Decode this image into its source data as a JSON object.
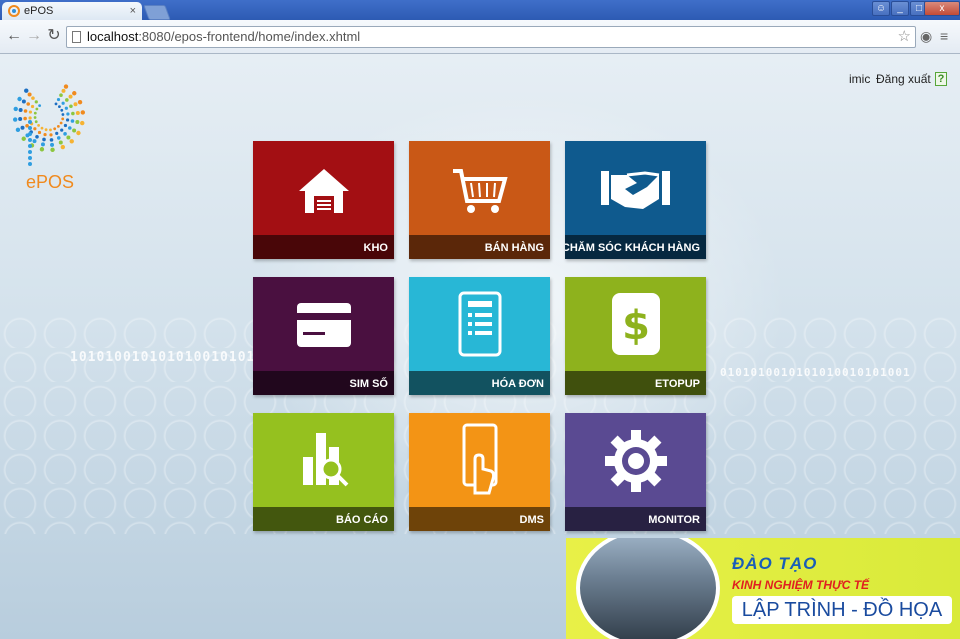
{
  "browser": {
    "tab_title": "ePOS",
    "tab_close": "×",
    "url_host": "localhost",
    "url_rest": ":8080/epos-frontend/home/index.xhtml",
    "win_buttons": [
      "_",
      "□",
      "x"
    ]
  },
  "header": {
    "logo_text": "ePOS",
    "username": "imic",
    "logout_label": "Đăng xuất",
    "help_label": "?"
  },
  "tiles": [
    {
      "label": "KHO",
      "color": "#a30f13",
      "icon": "warehouse-icon"
    },
    {
      "label": "BÁN HÀNG",
      "color": "#c95816",
      "icon": "shopping-cart-icon"
    },
    {
      "label": "CHĂM SÓC KHÁCH HÀNG",
      "color": "#0f5a8e",
      "icon": "handshake-icon"
    },
    {
      "label": "SIM SỐ",
      "color": "#4a1040",
      "icon": "sim-card-icon"
    },
    {
      "label": "HÓA ĐƠN",
      "color": "#28b7d6",
      "icon": "invoice-icon"
    },
    {
      "label": "ETOPUP",
      "color": "#8eb21d",
      "icon": "dollar-icon"
    },
    {
      "label": "BÁO CÁO",
      "color": "#95c11f",
      "icon": "report-chart-icon"
    },
    {
      "label": "DMS",
      "color": "#f39415",
      "icon": "mobile-touch-icon"
    },
    {
      "label": "MONITOR",
      "color": "#5a4a92",
      "icon": "gear-icon"
    }
  ],
  "ad": {
    "line1": "ĐÀO TẠO",
    "line2": "KINH NGHIỆM THỰC TẾ",
    "line3": "LẬP TRÌNH - ĐỒ HỌA"
  }
}
